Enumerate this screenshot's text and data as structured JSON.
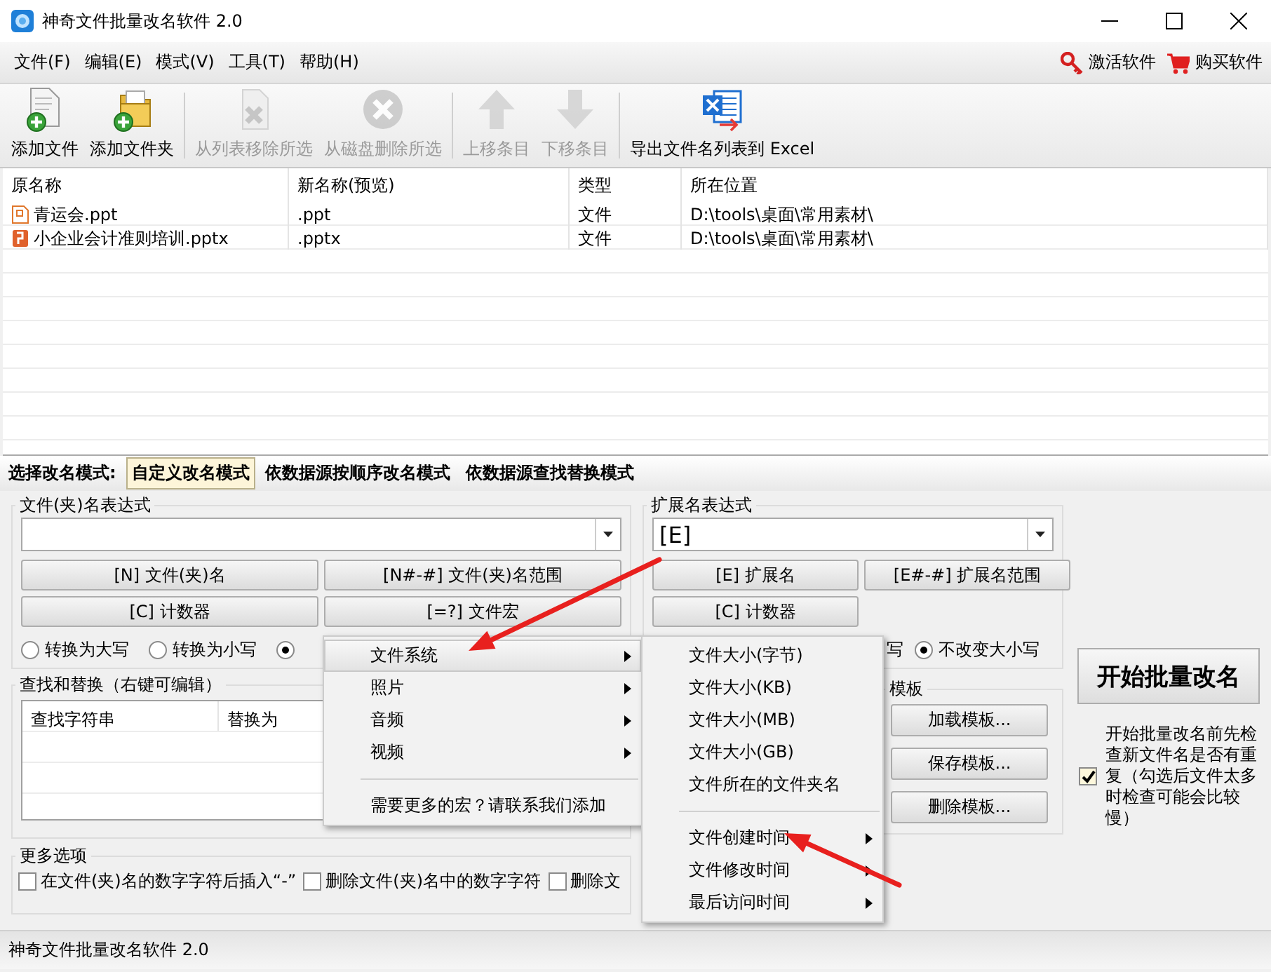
{
  "window": {
    "title": "神奇文件批量改名软件 2.0"
  },
  "menu": [
    "文件(F)",
    "编辑(E)",
    "模式(V)",
    "工具(T)",
    "帮助(H)"
  ],
  "menu_right": [
    {
      "label": "激活软件",
      "kind": "key"
    },
    {
      "label": "购买软件",
      "kind": "cart"
    }
  ],
  "toolbar": [
    {
      "label": "添加文件",
      "kind": "add-file",
      "disabled": false
    },
    {
      "label": "添加文件夹",
      "kind": "add-folder",
      "disabled": false
    },
    {
      "label": "从列表移除所选",
      "kind": "remove",
      "disabled": true
    },
    {
      "label": "从磁盘删除所选",
      "kind": "delete",
      "disabled": true
    },
    {
      "label": "上移条目",
      "kind": "up",
      "disabled": true
    },
    {
      "label": "下移条目",
      "kind": "down",
      "disabled": true
    },
    {
      "label": "导出文件名列表到 Excel",
      "kind": "excel",
      "disabled": false
    }
  ],
  "file_list": {
    "columns": [
      "原名称",
      "新名称(预览)",
      "类型",
      "所在位置"
    ],
    "rows": [
      {
        "kind": "ppt",
        "cells": [
          "青运会.ppt",
          ".ppt",
          "文件",
          "D:\\tools\\桌面\\常用素材\\"
        ]
      },
      {
        "kind": "pptx",
        "cells": [
          "小企业会计准则培训.pptx",
          ".pptx",
          "文件",
          "D:\\tools\\桌面\\常用素材\\"
        ]
      }
    ]
  },
  "mode_bar": {
    "label": "选择改名模式:",
    "modes": [
      {
        "label": "自定义改名模式",
        "selected": true
      },
      {
        "label": "依数据源按顺序改名模式",
        "selected": false
      },
      {
        "label": "依数据源查找替换模式",
        "selected": false
      }
    ]
  },
  "name_expression": {
    "title": "文件(夹)名表达式",
    "buttons": [
      "[N] 文件(夹)名",
      "[N#-#] 文件(夹)名范围",
      "[C] 计数器",
      "[=?] 文件宏"
    ],
    "radios": [
      {
        "label": "转换为大写",
        "selected": false
      },
      {
        "label": "转换为小写",
        "selected": false
      },
      {
        "selected": true
      }
    ]
  },
  "find_replace": {
    "title": "查找和替换（右键可编辑）",
    "columns": [
      "查找字符串",
      "替换为"
    ]
  },
  "more_options": {
    "title": "更多选项",
    "checkboxes": [
      {
        "label": "在文件(夹)名的数字字符后插入“-”",
        "checked": false
      },
      {
        "label": "删除文件(夹)名中的数字字符",
        "checked": false
      },
      {
        "label": "删除文",
        "checked": false
      }
    ]
  },
  "ext_expression": {
    "title": "扩展名表达式",
    "value": "[E]",
    "buttons": [
      "[E] 扩展名",
      "[E#-#] 扩展名范围",
      "[C] 计数器"
    ],
    "covered_text": "写",
    "radios": [
      {
        "label": "不改变大小写",
        "selected": true
      }
    ]
  },
  "templates": {
    "title": "模板",
    "buttons": [
      "加载模板...",
      "保存模板...",
      "删除模板..."
    ]
  },
  "start_button": "开始批量改名",
  "check_duplicates": {
    "label": "开始批量改名前先检查新文件名是否有重复（勾选后文件太多时检查可能会比较慢）",
    "checked": true
  },
  "status_bar": "神奇文件批量改名软件 2.0",
  "context_menu": {
    "items": [
      {
        "label": "文件系统",
        "kind": "submenu",
        "selected": true
      },
      {
        "label": "照片",
        "kind": "submenu",
        "selected": false
      },
      {
        "label": "音频",
        "kind": "submenu",
        "selected": false
      },
      {
        "label": "视频",
        "kind": "submenu",
        "selected": false
      },
      {
        "kind": "separator"
      },
      {
        "label": "需要更多的宏？请联系我们添加",
        "kind": "item",
        "selected": false
      }
    ]
  },
  "submenu": {
    "items": [
      {
        "label": "文件大小(字节)",
        "kind": "item"
      },
      {
        "label": "文件大小(KB)",
        "kind": "item"
      },
      {
        "label": "文件大小(MB)",
        "kind": "item"
      },
      {
        "label": "文件大小(GB)",
        "kind": "item"
      },
      {
        "label": "文件所在的文件夹名",
        "kind": "item"
      },
      {
        "kind": "separator"
      },
      {
        "label": "文件创建时间",
        "kind": "submenu"
      },
      {
        "label": "文件修改时间",
        "kind": "submenu"
      },
      {
        "label": "最后访问时间",
        "kind": "submenu"
      }
    ]
  },
  "annotations": [
    {
      "kind": "arrow"
    },
    {
      "kind": "arrow"
    }
  ]
}
